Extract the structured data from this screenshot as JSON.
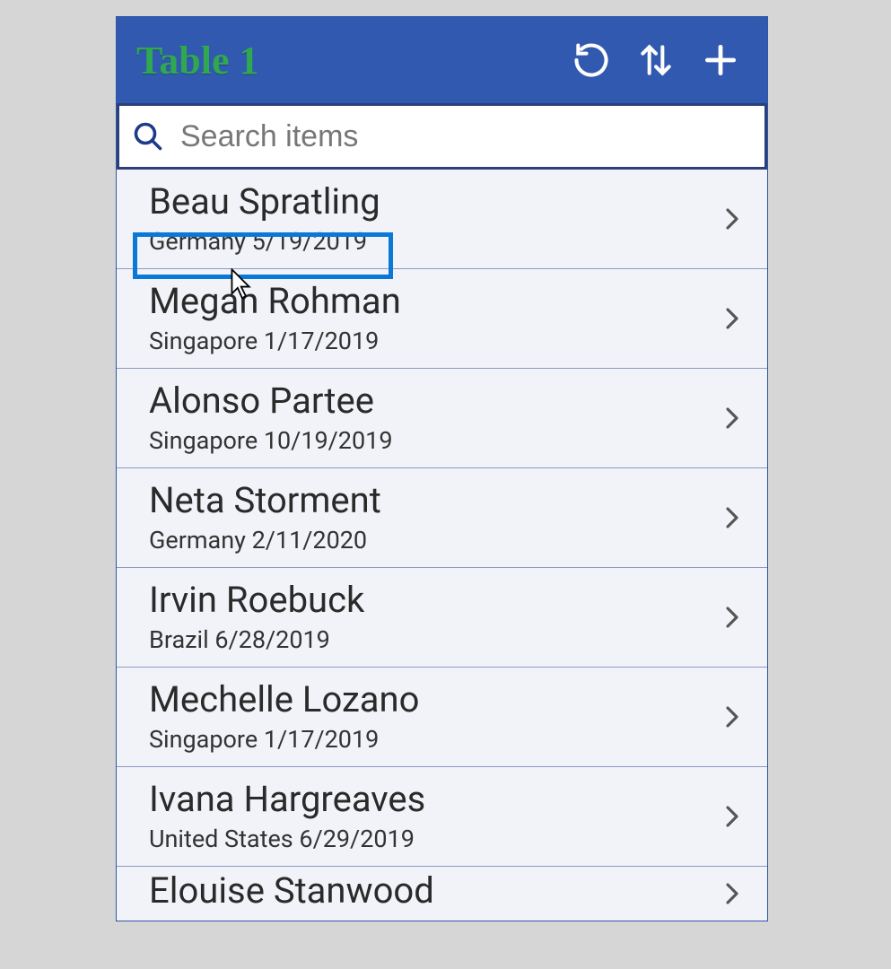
{
  "header": {
    "title": "Table 1",
    "icons": {
      "refresh": "refresh-icon",
      "sort": "sort-icon",
      "add": "add-icon"
    }
  },
  "search": {
    "placeholder": "Search items"
  },
  "items": [
    {
      "title": "Beau Spratling",
      "subtitle": "Germany 5/19/2019"
    },
    {
      "title": "Megan Rohman",
      "subtitle": "Singapore 1/17/2019"
    },
    {
      "title": "Alonso Partee",
      "subtitle": "Singapore 10/19/2019"
    },
    {
      "title": "Neta Storment",
      "subtitle": "Germany 2/11/2020"
    },
    {
      "title": "Irvin Roebuck",
      "subtitle": "Brazil 6/28/2019"
    },
    {
      "title": "Mechelle Lozano",
      "subtitle": "Singapore 1/17/2019"
    },
    {
      "title": "Ivana Hargreaves",
      "subtitle": "United States 6/29/2019"
    },
    {
      "title": "Elouise Stanwood",
      "subtitle": ""
    }
  ],
  "highlight": {
    "item_index": 0,
    "field": "subtitle"
  }
}
